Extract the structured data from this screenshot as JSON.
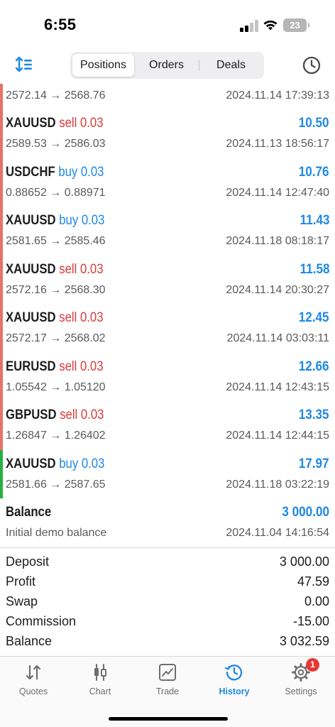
{
  "status_bar": {
    "time": "6:55",
    "battery": "23"
  },
  "toolbar": {
    "tabs": [
      {
        "label": "Positions",
        "active": true
      },
      {
        "label": "Orders",
        "active": false
      },
      {
        "label": "Deals",
        "active": false
      }
    ],
    "sort_icon": "sort-icon",
    "history_period_icon": "clock-icon"
  },
  "colors": {
    "accent": "#1e88e5",
    "sell": "#d93b3b",
    "buy": "#1e88e5",
    "side_bar_red": "#e57368",
    "side_bar_green": "#26b043"
  },
  "history": {
    "first_row": {
      "prices": "2572.14 → 2568.76",
      "time": "2024.11.14 17:39:13"
    },
    "rows": [
      {
        "symbol": "XAUUSD",
        "action": "sell 0.03",
        "type": "sell",
        "profit": "10.50",
        "prices": "2589.53 → 2586.03",
        "time": "2024.11.13 18:56:17"
      },
      {
        "symbol": "USDCHF",
        "action": "buy 0.03",
        "type": "buy",
        "profit": "10.76",
        "prices": "0.88652 → 0.88971",
        "time": "2024.11.14 12:47:40"
      },
      {
        "symbol": "XAUUSD",
        "action": "buy 0.03",
        "type": "buy",
        "profit": "11.43",
        "prices": "2581.65 → 2585.46",
        "time": "2024.11.18 08:18:17"
      },
      {
        "symbol": "XAUUSD",
        "action": "sell 0.03",
        "type": "sell",
        "profit": "11.58",
        "prices": "2572.16 → 2568.30",
        "time": "2024.11.14 20:30:27"
      },
      {
        "symbol": "XAUUSD",
        "action": "sell 0.03",
        "type": "sell",
        "profit": "12.45",
        "prices": "2572.17 → 2568.02",
        "time": "2024.11.14 03:03:11"
      },
      {
        "symbol": "EURUSD",
        "action": "sell 0.03",
        "type": "sell",
        "profit": "12.66",
        "prices": "1.05542 → 1.05120",
        "time": "2024.11.14 12:43:15"
      },
      {
        "symbol": "GBPUSD",
        "action": "sell 0.03",
        "type": "sell",
        "profit": "13.35",
        "prices": "1.26847 → 1.26402",
        "time": "2024.11.14 12:44:15"
      },
      {
        "symbol": "XAUUSD",
        "action": "buy 0.03",
        "type": "buy",
        "profit": "17.97",
        "prices": "2581.66 → 2587.65",
        "time": "2024.11.18 03:22:19"
      }
    ],
    "balance_row": {
      "symbol": "Balance",
      "profit": "3 000.00",
      "prices": "Initial demo balance",
      "time": "2024.11.04 14:16:54"
    }
  },
  "summary": [
    {
      "label": "Deposit",
      "value": "3 000.00"
    },
    {
      "label": "Profit",
      "value": "47.59"
    },
    {
      "label": "Swap",
      "value": "0.00"
    },
    {
      "label": "Commission",
      "value": "-15.00"
    },
    {
      "label": "Balance",
      "value": "3 032.59"
    }
  ],
  "tabbar": {
    "tabs": [
      {
        "label": "Quotes",
        "icon": "quotes-icon",
        "active": false
      },
      {
        "label": "Chart",
        "icon": "chart-icon",
        "active": false
      },
      {
        "label": "Trade",
        "icon": "trade-icon",
        "active": false
      },
      {
        "label": "History",
        "icon": "history-icon",
        "active": true
      },
      {
        "label": "Settings",
        "icon": "gear-icon",
        "active": false,
        "badge": "1"
      }
    ]
  }
}
